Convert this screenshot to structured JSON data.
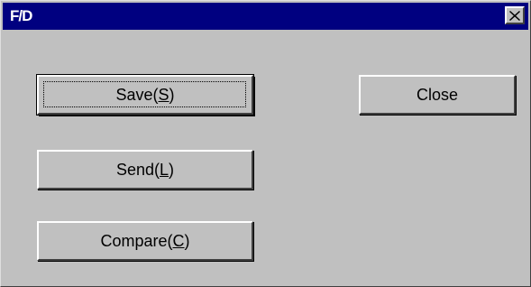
{
  "window": {
    "title": "F/D"
  },
  "buttons": {
    "save": {
      "prefix": "Save(",
      "mnemonic": "S",
      "suffix": ")"
    },
    "send": {
      "prefix": "Send(",
      "mnemonic": "L",
      "suffix": ")"
    },
    "compare": {
      "prefix": "Compare(",
      "mnemonic": "C",
      "suffix": ")"
    },
    "close": {
      "label": "Close"
    }
  },
  "colors": {
    "titlebar": "#000080",
    "face": "#c0c0c0"
  },
  "icons": {
    "titlebar_close": "close-icon"
  }
}
